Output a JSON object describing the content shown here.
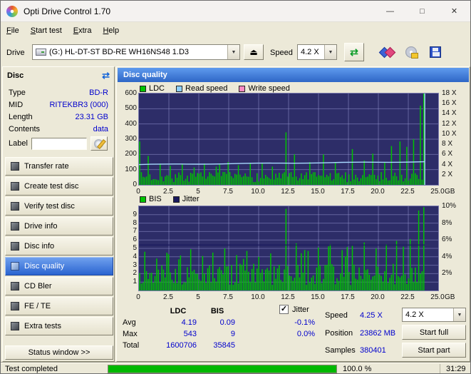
{
  "window": {
    "title": "Opti Drive Control 1.70"
  },
  "icons": {
    "minimize": "—",
    "maximize": "□",
    "close": "✕",
    "eject": "⏏",
    "dropdown": "▼",
    "refresh": "⇄",
    "check": "✓"
  },
  "menu": {
    "items": [
      {
        "label": "File"
      },
      {
        "label": "Start test"
      },
      {
        "label": "Extra"
      },
      {
        "label": "Help"
      }
    ]
  },
  "toolbar": {
    "drive_label": "Drive",
    "drive_value": "(G:)  HL-DT-ST BD-RE  WH16NS48 1.D3",
    "speed_label": "Speed",
    "speed_value": "4.2 X",
    "icon_buttons": [
      {
        "name": "test-discs-icon"
      },
      {
        "name": "disc-tools-icon"
      },
      {
        "name": "save-icon"
      }
    ]
  },
  "sidebar": {
    "header": "Disc",
    "fields": [
      {
        "label": "Type",
        "value": "BD-R"
      },
      {
        "label": "MID",
        "value": "RITEKBR3 (000)"
      },
      {
        "label": "Length",
        "value": "23.31 GB"
      },
      {
        "label": "Contents",
        "value": "data"
      }
    ],
    "label_row": {
      "label": "Label",
      "value": ""
    },
    "buttons": [
      {
        "label": "Transfer rate",
        "icon": "transfer-rate-icon"
      },
      {
        "label": "Create test disc",
        "icon": "create-test-disc-icon"
      },
      {
        "label": "Verify test disc",
        "icon": "verify-test-disc-icon"
      },
      {
        "label": "Drive info",
        "icon": "drive-info-icon"
      },
      {
        "label": "Disc info",
        "icon": "disc-info-icon"
      },
      {
        "label": "Disc quality",
        "icon": "disc-quality-icon",
        "active": true
      },
      {
        "label": "CD Bler",
        "icon": "cd-bler-icon"
      },
      {
        "label": "FE / TE",
        "icon": "fe-te-icon"
      },
      {
        "label": "Extra tests",
        "icon": "extra-tests-icon"
      }
    ],
    "status_button": "Status window >>"
  },
  "charts": {
    "panel_title": "Disc quality",
    "top": {
      "legend": [
        {
          "label": "LDC",
          "color": "#00c400"
        },
        {
          "label": "Read speed",
          "color": "#8ed0ff"
        },
        {
          "label": "Write speed",
          "color": "#ff8ac4"
        }
      ],
      "left_ticks": [
        "600",
        "500",
        "400",
        "300",
        "200",
        "100",
        "0"
      ],
      "right_ticks": [
        "18 X",
        "16 X",
        "14 X",
        "12 X",
        "10 X",
        "8 X",
        "6 X",
        "4 X",
        "2 X"
      ],
      "x_ticks": [
        "0",
        "2.5",
        "5",
        "7.5",
        "10.0",
        "12.5",
        "15.0",
        "17.5",
        "20.0",
        "22.5",
        "25.0"
      ],
      "x_unit": "GB",
      "y_max": 600,
      "right_axis_max": 18,
      "data_end_frac": 0.955,
      "bars": {
        "seed": 7,
        "count": 168,
        "base_min": 18,
        "base_max": 85,
        "spike_prob": 0.05,
        "spike_scale": 2.0,
        "color": "#00c400",
        "spikes": [
          [
            0.002,
            285
          ],
          [
            0.03,
            190
          ],
          [
            0.07,
            140
          ],
          [
            0.11,
            125
          ],
          [
            0.15,
            135
          ],
          [
            0.19,
            115
          ],
          [
            0.23,
            140
          ],
          [
            0.27,
            120
          ],
          [
            0.31,
            150
          ],
          [
            0.35,
            130
          ],
          [
            0.39,
            140
          ],
          [
            0.43,
            145
          ],
          [
            0.47,
            120
          ],
          [
            0.515,
            345
          ],
          [
            0.545,
            200
          ],
          [
            0.6,
            150
          ],
          [
            0.645,
            200
          ],
          [
            0.69,
            150
          ],
          [
            0.75,
            235
          ],
          [
            0.79,
            160
          ],
          [
            0.82,
            205
          ],
          [
            0.86,
            150
          ],
          [
            0.885,
            255
          ],
          [
            0.915,
            285
          ],
          [
            0.94,
            250
          ],
          [
            0.965,
            300
          ],
          [
            0.99,
            520
          ],
          [
            1,
            600
          ]
        ]
      },
      "read_speed": {
        "start": 4.0,
        "end": 4.55,
        "color": "#a8d8ff"
      }
    },
    "bottom": {
      "legend": [
        {
          "label": "BIS",
          "color": "#00c400"
        },
        {
          "label": "Jitter",
          "color": "#1a1a5e"
        }
      ],
      "left_ticks": [
        "9",
        "8",
        "7",
        "6",
        "5",
        "4",
        "3",
        "2",
        "1"
      ],
      "right_ticks": [
        "10%",
        "8%",
        "6%",
        "4%",
        "2%"
      ],
      "x_ticks": [
        "0",
        "2.5",
        "5",
        "7.5",
        "10.0",
        "12.5",
        "15.0",
        "17.5",
        "20.0",
        "22.5",
        "25.0"
      ],
      "x_unit": "GB",
      "y_max": 10,
      "data_end_frac": 0.955,
      "bars": {
        "seed": 13,
        "count": 168,
        "base_min": 0.6,
        "base_max": 3.2,
        "spike_prob": 0.15,
        "spike_scale": 1.6,
        "color": "#00c400",
        "spikes": [
          [
            0.02,
            4.6
          ],
          [
            0.06,
            3.8
          ],
          [
            0.1,
            4.3
          ],
          [
            0.14,
            3.7
          ],
          [
            0.18,
            4.9
          ],
          [
            0.22,
            4.1
          ],
          [
            0.26,
            4.5
          ],
          [
            0.3,
            5.0
          ],
          [
            0.34,
            4.2
          ],
          [
            0.38,
            4.7
          ],
          [
            0.42,
            4.0
          ],
          [
            0.46,
            4.4
          ],
          [
            0.515,
            9.7
          ],
          [
            0.55,
            5.6
          ],
          [
            0.59,
            4.7
          ],
          [
            0.63,
            5.1
          ],
          [
            0.67,
            5.5
          ],
          [
            0.71,
            4.8
          ],
          [
            0.75,
            5.3
          ],
          [
            0.79,
            5.7
          ],
          [
            0.83,
            5.0
          ],
          [
            0.87,
            5.5
          ],
          [
            0.905,
            5.9
          ],
          [
            0.93,
            5.2
          ],
          [
            0.955,
            6.1
          ],
          [
            0.985,
            9.5
          ],
          [
            1,
            9.9
          ]
        ]
      },
      "jitter_line": {
        "value": 5.4,
        "color": "#1a1a5e"
      }
    }
  },
  "stats": {
    "col_headers": [
      "LDC",
      "BIS"
    ],
    "rows": [
      {
        "label": "Avg",
        "ldc": "4.19",
        "bis": "0.09",
        "jitter": "-0.1%"
      },
      {
        "label": "Max",
        "ldc": "543",
        "bis": "9",
        "jitter": "0.0%"
      },
      {
        "label": "Total",
        "ldc": "1600706",
        "bis": "35845",
        "jitter": ""
      }
    ],
    "jitter_label": "Jitter",
    "speed": {
      "label": "Speed",
      "value": "4.25 X",
      "dropdown": "4.2 X"
    },
    "position": {
      "label": "Position",
      "value": "23862 MB",
      "button": "Start full"
    },
    "samples": {
      "label": "Samples",
      "value": "380401",
      "button": "Start part"
    }
  },
  "statusbar": {
    "text": "Test completed",
    "percent": "100.0 %",
    "time": "31:29",
    "progress_pct": 100
  }
}
